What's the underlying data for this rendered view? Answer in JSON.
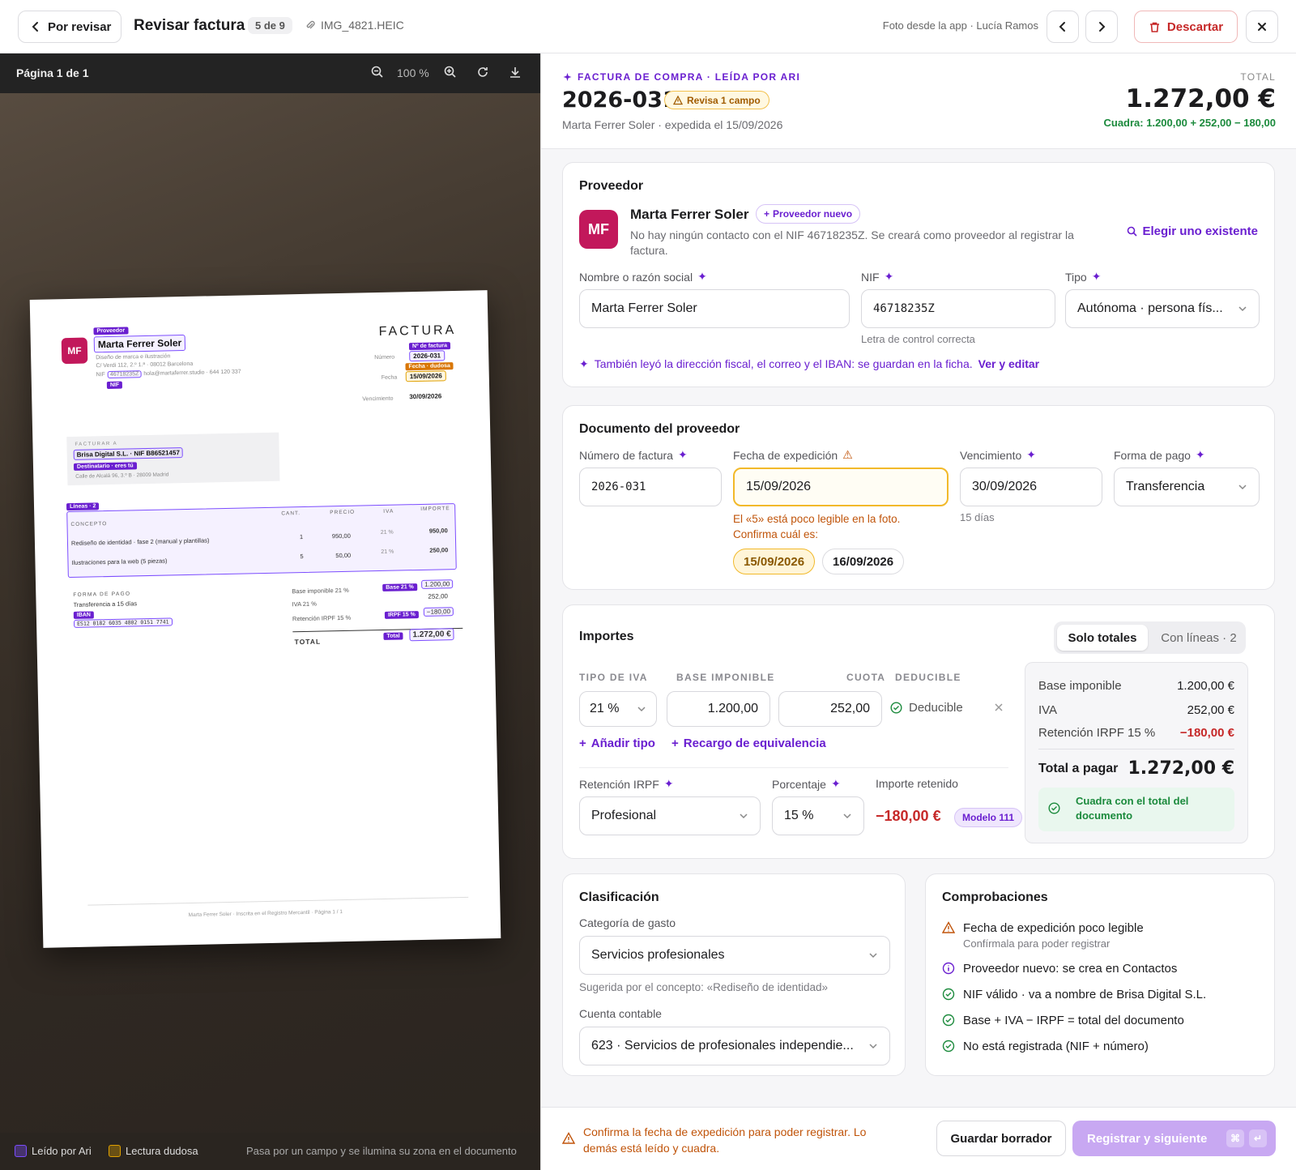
{
  "topbar": {
    "back_label": "Por revisar",
    "title": "Revisar factura",
    "counter": "5 de 9",
    "file_name": "IMG_4821.HEIC",
    "source": "Foto desde la app · Lucía Ramos",
    "discard_label": "Descartar"
  },
  "viewer": {
    "page_label": "Página 1 de 1",
    "zoom": "100 %",
    "legend_read": "Leído por Ari",
    "legend_doubt": "Lectura dudosa",
    "legend_hint": "Pasa por un campo y se ilumina su zona en el documento",
    "colors": {
      "read": "#7c4dff",
      "doubt": "#e0a000"
    }
  },
  "document": {
    "mf": "MF",
    "tag_provider": "Proveedor",
    "provider_name": "Marta Ferrer Soler",
    "provider_desc": "Diseño de marca e ilustración",
    "provider_addr": "C/ Verdi 112, 2.º 1.ª · 08012 Barcelona",
    "nif_prefix": "NIF",
    "nif": "46718235Z",
    "contact": "hola@martaferrer.studio · 644 120 337",
    "tag_nif": "NIF",
    "heading": "FACTURA",
    "tag_number": "Nº de factura",
    "lbl_number": "Número",
    "number": "2026-031",
    "tag_date": "Fecha · dudosa",
    "lbl_date": "Fecha",
    "date": "15/09/2026",
    "lbl_due": "Vencimiento",
    "due": "30/09/2026",
    "bill_to_lbl": "FACTURAR A",
    "bill_to": "Brisa Digital S.L. · NIF B86521457",
    "tag_recipient": "Destinatario · eres tú",
    "bill_addr": "Calle de Alcalá 96, 3.º B · 28009 Madrid",
    "tag_lines": "Líneas · 2",
    "col_concept": "CONCEPTO",
    "col_qty": "CANT.",
    "col_price": "PRECIO",
    "col_vat": "IVA",
    "col_amount": "IMPORTE",
    "lines": [
      {
        "concept": "Rediseño de identidad · fase 2 (manual y plantillas)",
        "qty": "1",
        "price": "950,00",
        "vat": "21 %",
        "amount": "950,00"
      },
      {
        "concept": "Ilustraciones para la web (5 piezas)",
        "qty": "5",
        "price": "50,00",
        "vat": "21 %",
        "amount": "250,00"
      }
    ],
    "pay_lbl": "FORMA DE PAGO",
    "pay": "Transferencia a 15 días",
    "tag_iban": "IBAN",
    "iban": "ES12 0182 6035 4802 0151 7741",
    "base_lbl": "Base imponible 21 %",
    "tag_base": "Base 21 %",
    "base": "1.200,00",
    "vat_lbl": "IVA 21 %",
    "vat": "252,00",
    "irpf_lbl": "Retención IRPF 15 %",
    "tag_irpf": "IRPF 15 %",
    "irpf": "−180,00",
    "total_lbl": "TOTAL",
    "tag_total": "Total",
    "total": "1.272,00 €",
    "footer": "Marta Ferrer Soler · Inscrita en el Registro Mercantil · Página 1 / 1"
  },
  "header": {
    "eyebrow": "FACTURA DE COMPRA · LEÍDA POR ARI",
    "number": "2026-031",
    "review_pill": "Revisa 1 campo",
    "subtitle": "Marta Ferrer Soler · expedida el 15/09/2026",
    "total_label": "TOTAL",
    "total_value": "1.272,00 €",
    "total_check": "Cuadra: 1.200,00 + 252,00 − 180,00"
  },
  "provider": {
    "title": "Proveedor",
    "avatar": "MF",
    "name": "Marta Ferrer Soler",
    "new_badge": "Proveedor nuevo",
    "note": "No hay ningún contacto con el NIF 46718235Z. Se creará como proveedor al registrar la factura.",
    "choose_existing": "Elegir uno existente",
    "lbl_name": "Nombre o razón social",
    "val_name": "Marta Ferrer Soler",
    "lbl_nif": "NIF",
    "val_nif": "46718235Z",
    "nif_hint": "Letra de control correcta",
    "lbl_type": "Tipo",
    "val_type": "Autónoma · persona fís...",
    "extra_note": "También leyó la dirección fiscal, el correo y el IBAN: se guardan en la ficha.",
    "extra_link": "Ver y editar"
  },
  "docprov": {
    "title": "Documento del proveedor",
    "lbl_number": "Número de factura",
    "val_number": "2026-031",
    "lbl_date": "Fecha de expedición",
    "val_date": "15/09/2026",
    "date_warn": "El «5» está poco legible en la foto. Confirma cuál es:",
    "chip_a": "15/09/2026",
    "chip_b": "16/09/2026",
    "lbl_due": "Vencimiento",
    "val_due": "30/09/2026",
    "due_hint": "15 días",
    "lbl_pay": "Forma de pago",
    "val_pay": "Transferencia"
  },
  "amounts": {
    "title": "Importes",
    "seg_totals": "Solo totales",
    "seg_lines": "Con líneas · 2",
    "col_vat_type": "TIPO DE IVA",
    "col_base": "BASE IMPONIBLE",
    "col_quota": "CUOTA",
    "col_deductible": "DEDUCIBLE",
    "vat_type": "21 %",
    "base": "1.200,00",
    "quota": "252,00",
    "deductible": "Deducible",
    "add_type": "Añadir tipo",
    "add_surcharge": "Recargo de equivalencia",
    "lbl_irpf": "Retención IRPF",
    "val_irpf": "Profesional",
    "lbl_pct": "Porcentaje",
    "val_pct": "15 %",
    "lbl_withheld": "Importe retenido",
    "val_withheld": "−180,00 €",
    "model_badge": "Modelo 111",
    "sum_base_lbl": "Base imponible",
    "sum_base": "1.200,00 €",
    "sum_vat_lbl": "IVA",
    "sum_vat": "252,00 €",
    "sum_irpf_lbl": "Retención IRPF 15 %",
    "sum_irpf": "−180,00 €",
    "sum_total_lbl": "Total a pagar",
    "sum_total": "1.272,00 €",
    "sum_ok": "Cuadra con el total del documento"
  },
  "classification": {
    "title": "Clasificación",
    "lbl_category": "Categoría de gasto",
    "val_category": "Servicios profesionales",
    "category_hint": "Sugerida por el concepto: «Rediseño de identidad»",
    "lbl_account": "Cuenta contable",
    "val_account": "623 · Servicios de profesionales independie..."
  },
  "checks": {
    "title": "Comprobaciones",
    "items": [
      {
        "text": "Fecha de expedición poco legible",
        "sub": "Confírmala para poder registrar",
        "status": "warning"
      },
      {
        "text": "Proveedor nuevo: se crea en Contactos",
        "status": "info"
      },
      {
        "text": "NIF válido · va a nombre de Brisa Digital S.L.",
        "status": "ok"
      },
      {
        "text": "Base + IVA − IRPF = total del documento",
        "status": "ok"
      },
      {
        "text": "No está registrada (NIF + número)",
        "status": "ok"
      }
    ]
  },
  "footer": {
    "warning": "Confirma la fecha de expedición para poder registrar. Lo demás está leído y cuadra.",
    "draft": "Guardar borrador",
    "register": "Registrar y siguiente",
    "kbd_cmd": "⌘",
    "kbd_enter": "↵"
  },
  "colors": {
    "accent": "#6a1fd0",
    "warning": "#f2b92a",
    "ok": "#1b8a3c",
    "danger": "#c62828",
    "brand": "#c2185b"
  }
}
